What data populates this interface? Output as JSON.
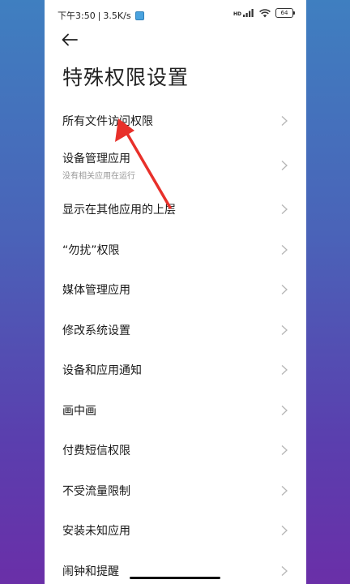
{
  "status_bar": {
    "time": "下午3:50",
    "separator": "|",
    "net_speed": "3.5K/s",
    "signal_label": "HD",
    "battery": "64"
  },
  "header": {
    "title": "特殊权限设置"
  },
  "items": [
    {
      "label": "所有文件访问权限"
    },
    {
      "label": "设备管理应用",
      "sub": "没有相关应用在运行"
    },
    {
      "label": "显示在其他应用的上层"
    },
    {
      "label": "“勿扰”权限"
    },
    {
      "label": "媒体管理应用"
    },
    {
      "label": "修改系统设置"
    },
    {
      "label": "设备和应用通知"
    },
    {
      "label": "画中画"
    },
    {
      "label": "付费短信权限"
    },
    {
      "label": "不受流量限制"
    },
    {
      "label": "安装未知应用"
    },
    {
      "label": "闹钟和提醒"
    }
  ],
  "colors": {
    "annotation_arrow": "#e8302a",
    "page_background": "#ffffff",
    "chevron": "#b5b5b5"
  }
}
